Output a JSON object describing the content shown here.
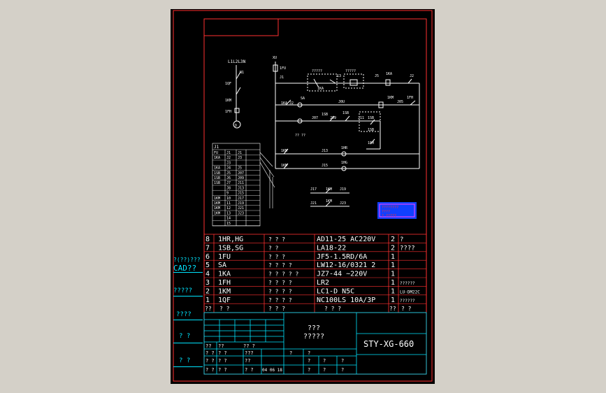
{
  "drawing": {
    "number": "STY-XG-660",
    "title_lines": [
      "???",
      "?????"
    ]
  },
  "side_labels": [
    {
      "text": "?(??)???",
      "color": "#00e5ff"
    },
    {
      "text": "CAD??",
      "color": "#00e5ff"
    },
    {
      "text": "?????",
      "color": "#00e5ff"
    },
    {
      "text": "????",
      "color": "#00e5ff"
    },
    {
      "text": "? ?",
      "color": "#00e5ff"
    },
    {
      "text": "? ?",
      "color": "#00e5ff"
    }
  ],
  "power_labels": [
    "L1L2L3N",
    "N1",
    "1QF",
    "1KM",
    "1FH",
    "D"
  ],
  "circuit_labels": {
    "xu": "XU",
    "fu": "1FU",
    "j1": "J1",
    "q1": "?????",
    "q2": "?????",
    "ka_top": "1KA",
    "j3": "13",
    "j5": "J5",
    "ka_right": "1KA",
    "j2": "J2",
    "sa": "SA",
    "ka2": "1KA J2",
    "j0": "J0U",
    "km": "1KM",
    "j05": "J05",
    "fh": "1FH",
    "j07": "J07",
    "j09": "J09",
    "sb": "1SB",
    "sb2": "1SB",
    "j11": "J11",
    "j13b": "1SB",
    "sb3": "1SB",
    "fh2": "1FH",
    "qq": "?? ??",
    "km2": "1KM",
    "j13": "J13",
    "hr": "1HR",
    "km3": "1KM",
    "j15": "J15",
    "hg": "1HG",
    "j17": "J17",
    "km4": "1KM",
    "j19": "J19",
    "j21": "J21",
    "km5": "1KM",
    "j23": "J23"
  },
  "terminal_block": {
    "header": "J1",
    "rows": [
      [
        "FU",
        "J1",
        "J1"
      ],
      [
        "1KA",
        "J2",
        "J3"
      ],
      [
        "",
        "J3",
        ""
      ],
      [
        "1KA",
        "J4",
        "J5"
      ],
      [
        "1SB",
        "J5",
        "J07"
      ],
      [
        "1SB",
        "J6",
        "J09"
      ],
      [
        "1SB",
        "J7",
        "J11"
      ],
      [
        "",
        "J8",
        "J13"
      ],
      [
        "",
        "9",
        "J15"
      ],
      [
        "1KM",
        "10",
        "J17"
      ],
      [
        "1KM",
        "11",
        "J19"
      ],
      [
        "1KM",
        "12",
        "J21"
      ],
      [
        "1KM",
        "13",
        "J23"
      ],
      [
        "",
        "14",
        ""
      ],
      [
        "",
        "15",
        ""
      ]
    ]
  },
  "stamp": {
    "lines": [
      "????????",
      "????",
      "? ?????"
    ]
  },
  "bom": [
    {
      "no": "8",
      "code": "1HR,HG",
      "name": "? ? ?",
      "model": "AD11-25 AC220V",
      "qty": "2",
      "note": "?"
    },
    {
      "no": "7",
      "code": "1SB,SG",
      "name": "? ?",
      "model": "LA18-22",
      "qty": "2",
      "note": "????"
    },
    {
      "no": "6",
      "code": "1FU",
      "name": "? ? ?",
      "model": "JF5-1.5RD/6A",
      "qty": "1",
      "note": ""
    },
    {
      "no": "5",
      "code": "SA",
      "name": "? ? ? ?",
      "model": "LW12-16/0321 2",
      "qty": "1",
      "note": ""
    },
    {
      "no": "4",
      "code": "1KA",
      "name": "? ? ? ? ?",
      "model": "JZ7-44 ~220V",
      "qty": "1",
      "note": ""
    },
    {
      "no": "3",
      "code": "1FH",
      "name": "? ? ? ?",
      "model": "LR2",
      "qty": "1",
      "note": "??????"
    },
    {
      "no": "2",
      "code": "1KM",
      "name": "? ? ? ?",
      "model": "LC1-D N5C",
      "qty": "1",
      "note": "LU-DM22C"
    },
    {
      "no": "1",
      "code": "1QF",
      "name": "? ? ? ?",
      "model": "NC100LS 10A/3P",
      "qty": "1",
      "note": "??????"
    }
  ],
  "bom_header": {
    "no": "??",
    "code": "? ?",
    "name": "? ? ?",
    "model": "? ? ?",
    "qty": "??",
    "note": "? ?"
  },
  "title_block": {
    "left_cells": [
      "??",
      "??",
      "?? ?",
      "???",
      "? ?",
      "? ?",
      "? ?",
      "? ?",
      "??",
      "? ?",
      "? ?",
      "? ?"
    ],
    "row_cells": [
      "?",
      "?",
      "?",
      "?",
      "?",
      "?",
      "?",
      "?"
    ],
    "date": "04 06 18"
  },
  "colors": {
    "frame": "#ff3030",
    "white": "#ffffff",
    "cyan": "#00e5ff",
    "yellow": "#ffff00",
    "green": "#00ff66",
    "blue": "#1040ff",
    "magenta": "#ff40ff"
  }
}
